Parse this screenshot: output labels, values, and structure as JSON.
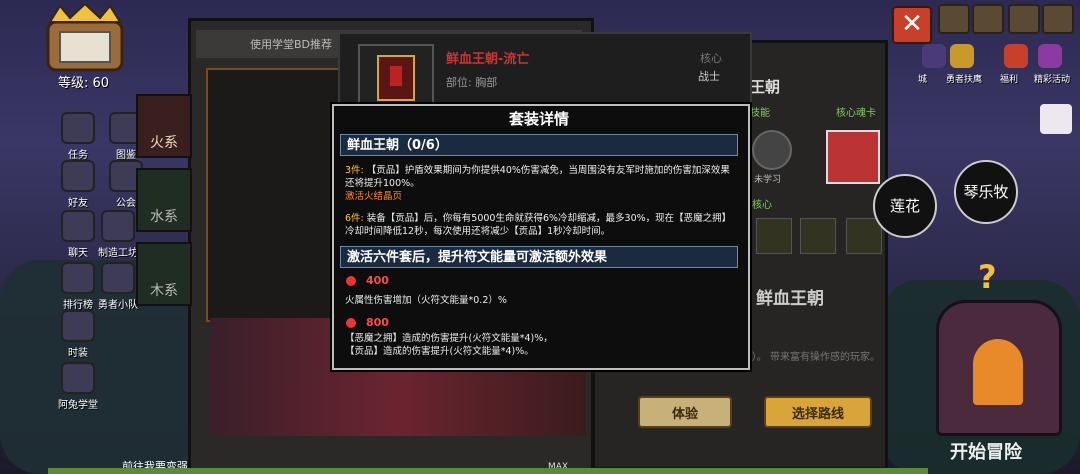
{
  "header": {
    "level": "等级: 60",
    "banner": "使用学堂BD推荐"
  },
  "left_menu": [
    {
      "label": "任务",
      "icon": "task-icon"
    },
    {
      "label": "图鉴",
      "icon": "book-icon"
    },
    {
      "label": "好友",
      "icon": "friend-icon"
    },
    {
      "label": "公会",
      "icon": "guild-icon"
    },
    {
      "label": "聊天",
      "icon": "chat-icon"
    },
    {
      "label": "制造工坊",
      "icon": "forge-icon"
    },
    {
      "label": "排行榜",
      "icon": "trophy-icon"
    },
    {
      "label": "勇者小队",
      "icon": "team-icon"
    },
    {
      "label": "时装",
      "icon": "fashion-icon"
    },
    {
      "label": "阿兔学堂",
      "icon": "school-icon"
    }
  ],
  "element_tabs": [
    {
      "label": "火系"
    },
    {
      "label": "水系"
    },
    {
      "label": "木系"
    }
  ],
  "top_right": {
    "labels": [
      "城",
      "勇者扶鹰",
      "福利",
      "精彩活动"
    ]
  },
  "item": {
    "name": "鲜血王朝-流亡",
    "part": "部位: 胸部",
    "core_label": "核心",
    "class": "战士"
  },
  "right_panel": {
    "title": "王朝",
    "skill_label": "技能",
    "core_card_label": "核心魂卡",
    "not_learned": "未学习",
    "core_label": "核心",
    "set_name": "鲜血王朝",
    "desc": "量的战士（弑神战）。 带来富有操作感的玩家。",
    "btn_try": "体验",
    "btn_route": "选择路线",
    "start": "开始冒险",
    "bottom_left": "前往我要变强",
    "max": "MAX"
  },
  "modal": {
    "title": "套装详情",
    "set_header": "鲜血王朝（0/6）",
    "three_piece_key": "3件:",
    "three_piece_text": "【贡品】护盾效果期间为你提供40%伤害减免，当周围没有友军时施加的伤害加深效果还将提升100%。",
    "three_piece_activate": "激活火结晶页",
    "six_piece_key": "6件:",
    "six_piece_text": "装备【贡品】后，你每有5000生命就获得6%冷却缩减，最多30%，现在【恶魔之拥】冷却时间降低12秒，每次使用还将减少【贡品】1秒冷却时间。",
    "rune_header": "激活六件套后，提升符文能量可激活额外效果",
    "tier1_value": "400",
    "tier1_text": "火属性伤害增加（火符文能量*0.2）%",
    "tier2_value": "800",
    "tier2_text1": "【恶魔之拥】造成的伤害提升(火符文能量*4)%，",
    "tier2_text2": "【贡品】造成的伤害提升(火符文能量*4)%。"
  },
  "side_buttons": {
    "lianhua": "莲花",
    "qinyue": "琴乐牧"
  },
  "colors": {
    "accent": "#ff8a1f",
    "header_bar": "#1b2b3f",
    "close": "#c8402a"
  }
}
